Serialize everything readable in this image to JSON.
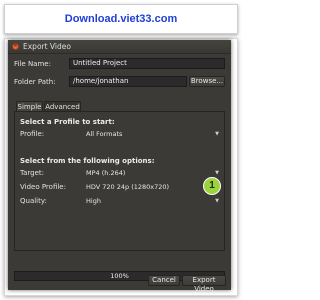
{
  "banner": {
    "text": "Download.viet33.com"
  },
  "dialog": {
    "title": "Export Video",
    "file_name_label": "File Name:",
    "file_name_value": "Untitled Project",
    "folder_path_label": "Folder Path:",
    "folder_path_value": "/home/jonathan",
    "browse_label": "Browse...",
    "tabs": [
      {
        "label": "Simple",
        "active": true
      },
      {
        "label": "Advanced",
        "active": false
      }
    ],
    "section_profile": "Select a Profile to start:",
    "profile_label": "Profile:",
    "profile_value": "All Formats",
    "section_options": "Select from the following options:",
    "target_label": "Target:",
    "target_value": "MP4 (h.264)",
    "video_profile_label": "Video Profile:",
    "video_profile_value": "HDV 720 24p (1280x720)",
    "quality_label": "Quality:",
    "quality_value": "High",
    "progress_text": "100%",
    "cancel_label": "Cancel",
    "export_label": "Export Video"
  },
  "callout": {
    "number": "1",
    "color": "#9ad33e"
  },
  "colors": {
    "banner_text": "#1e3fd6",
    "dialog_bg": "#3b3a36",
    "close_button": "#e26a3c"
  }
}
